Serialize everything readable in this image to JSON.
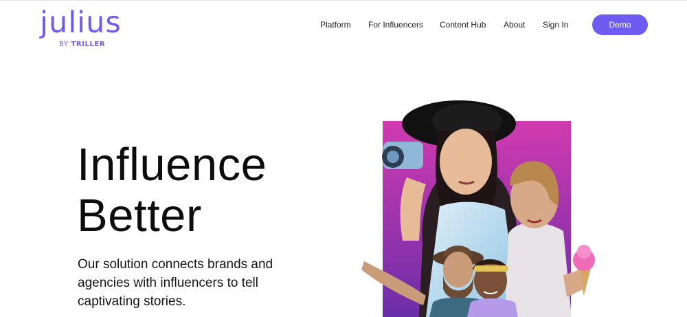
{
  "brand": {
    "name": "julius",
    "byline_prefix": "BY",
    "byline_brand": "TRILLER",
    "accent": "#6e5cf0"
  },
  "nav": {
    "items": [
      {
        "label": "Platform"
      },
      {
        "label": "For Influencers"
      },
      {
        "label": "Content Hub"
      },
      {
        "label": "About"
      },
      {
        "label": "Sign In"
      }
    ],
    "demo_label": "Demo"
  },
  "hero": {
    "title_line1": "Influence",
    "title_line2": "Better",
    "subtitle": "Our solution connects brands and agencies with influencers to tell captivating stories."
  },
  "colors": {
    "background": "#ffffff",
    "hero_panel_top": "#d23ab0",
    "hero_panel_bottom": "#6a2ea8"
  }
}
